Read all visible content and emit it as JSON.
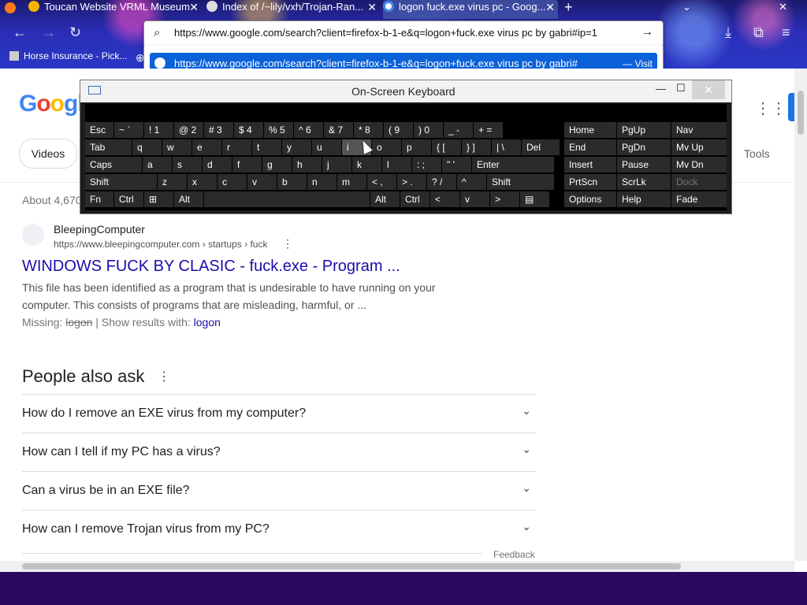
{
  "browser": {
    "tabs": [
      {
        "title": "Toucan Website VRML Museum"
      },
      {
        "title": "Index of /~lily/vxh/Trojan-Ran..."
      },
      {
        "title": "logon fuck.exe virus pc - Goog..."
      }
    ],
    "new_tab": "+",
    "url": "https://www.google.com/search?client=firefox-b-1-e&q=logon+fuck.exe virus pc by gabri#ip=1",
    "suggestion_url": "https://www.google.com/search?client=firefox-b-1-e&q=logon+fuck.exe virus pc by gabri#",
    "suggestion_action": "— Visit",
    "bookmark": "Horse Insurance - Pick..."
  },
  "google": {
    "logo": "Googl",
    "filter_chip": "Videos",
    "tools": "Tools",
    "result_count": "About 4,670",
    "result": {
      "site_name": "BleepingComputer",
      "breadcrumb": "https://www.bleepingcomputer.com › startups › fuck",
      "title": "WINDOWS FUCK BY CLASIC - fuck.exe - Program ...",
      "snippet_line1": "This file has been identified as a program that is undesirable to have running on your",
      "snippet_line2": "computer. This consists of programs that are misleading, harmful, or ...",
      "missing_label": "Missing:",
      "missing_word": "logon",
      "show_results": " | Show results with:",
      "show_results_link": "logon"
    },
    "paa_heading": "People also ask",
    "paa": [
      "How do I remove an EXE virus from my computer?",
      "How can I tell if my PC has a virus?",
      "Can a virus be in an EXE file?",
      "How can I remove Trojan virus from my PC?"
    ],
    "feedback": "Feedback"
  },
  "osk": {
    "title": "On-Screen Keyboard",
    "row1": [
      "Esc",
      "~ `",
      "! 1",
      "@ 2",
      "# 3",
      "$ 4",
      "% 5",
      "^ 6",
      "& 7",
      "* 8",
      "( 9",
      ") 0",
      "_ -",
      "+ ="
    ],
    "row2": [
      "Tab",
      "q",
      "w",
      "e",
      "r",
      "t",
      "y",
      "u",
      "i",
      "o",
      "p",
      "{ [",
      "} ]",
      "| \\",
      "Del"
    ],
    "row3": [
      "Caps",
      "a",
      "s",
      "d",
      "f",
      "g",
      "h",
      "j",
      "k",
      "l",
      ": ;",
      "\" '",
      "Enter"
    ],
    "row4": [
      "Shift",
      "z",
      "x",
      "c",
      "v",
      "b",
      "n",
      "m",
      "< ,",
      "> .",
      "? /",
      "^",
      "Shift"
    ],
    "row5": [
      "Fn",
      "Ctrl",
      "⊞",
      "Alt",
      "",
      "Alt",
      "Ctrl",
      "<",
      "v",
      ">",
      "▤"
    ],
    "nav": [
      [
        "Home",
        "PgUp",
        "Nav"
      ],
      [
        "End",
        "PgDn",
        "Mv Up"
      ],
      [
        "Insert",
        "Pause",
        "Mv Dn"
      ],
      [
        "PrtScn",
        "ScrLk",
        "Dock"
      ],
      [
        "Options",
        "Help",
        "Fade"
      ]
    ]
  }
}
